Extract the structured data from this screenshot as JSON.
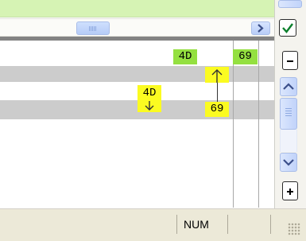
{
  "notes": {
    "row1_left": "4D",
    "row1_right": "69",
    "row3_mid": "4D",
    "row3_bottom": "69"
  },
  "status_bar": {
    "num": "NUM"
  },
  "icons": {
    "scroll_right": "chevron-right-icon",
    "check": "checkmark-icon",
    "scroll_up": "chevron-up-icon",
    "scroll_down": "chevron-down-icon",
    "minus": "minus-icon",
    "plus": "plus-icon"
  },
  "colors": {
    "header_green": "#d6f3b4",
    "note_green": "#94e040",
    "note_yellow": "#fbfb21",
    "row_gray": "#cccccc",
    "status_bg": "#ece9d8"
  }
}
